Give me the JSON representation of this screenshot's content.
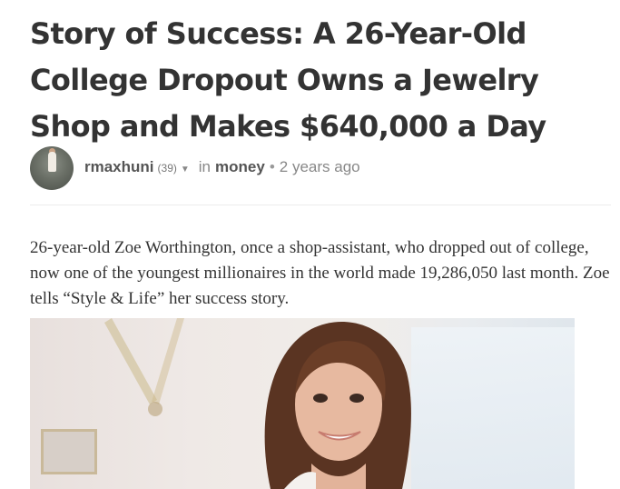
{
  "article": {
    "title": "Story of Success: A 26-Year-Old College Dropout Owns a Jewelry Shop and Makes $640,000 a Day",
    "author": "rmaxhuni",
    "reputation": "(39)",
    "in_label": "in",
    "community": "money",
    "separator": "•",
    "time_ago": "2 years ago",
    "body": "26-year-old Zoe Worthington, once a shop-assistant, who dropped out of college, now one of the youngest millionaires in the world made 19,286,050 last month. Zoe tells “Style & Life” her success story."
  },
  "icons": {
    "author_menu": "chevron-down-icon"
  },
  "colors": {
    "title": "#333333",
    "meta_text": "#888888",
    "author": "#555555",
    "body_text": "#333333",
    "divider": "#ececec"
  }
}
